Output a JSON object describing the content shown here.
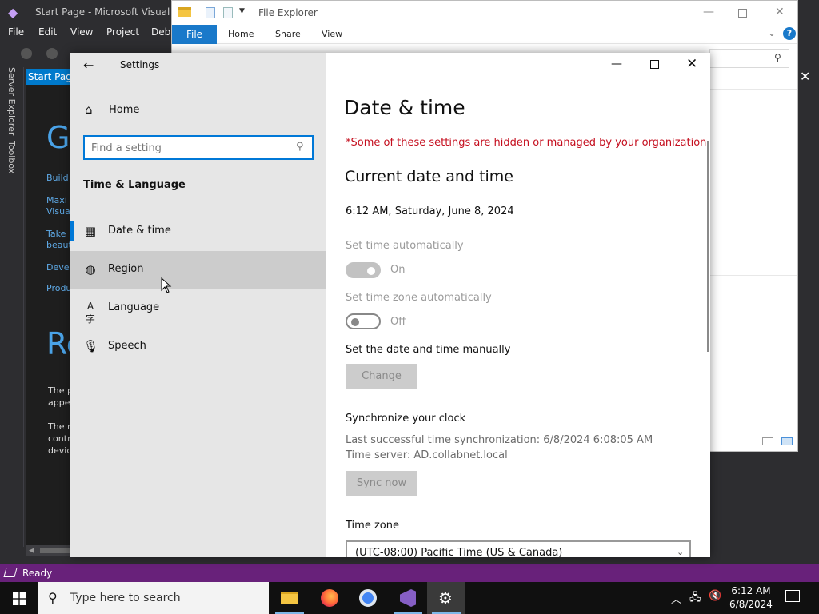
{
  "visual_studio": {
    "title": "Start Page - Microsoft Visual Stu",
    "menu": [
      "File",
      "Edit",
      "View",
      "Project",
      "Debu"
    ],
    "side_tabs": [
      "Server Explorer",
      "Toolbox"
    ],
    "doc_tab": "Start Page",
    "doc_fragments": {
      "heading1": "G",
      "link_build": "Build",
      "link_maxi_1": "Maxi",
      "link_maxi_2": "Visua",
      "link_take_1": "Take",
      "link_take_2": "beaut",
      "link_devel": "Devel",
      "link_produ": "Produ",
      "heading2": "Re",
      "text_p1_1": "The p",
      "text_p1_2": "appe",
      "text_p2_1": "The r",
      "text_p2_2": "contr",
      "text_p2_3": "devic"
    },
    "status": "Ready",
    "accent_color": "#68217a"
  },
  "file_explorer": {
    "title": "File Explorer",
    "ribbon_tabs": [
      "File",
      "Home",
      "Share",
      "View"
    ],
    "help_label": "?"
  },
  "settings": {
    "app_title": "Settings",
    "home_label": "Home",
    "search_placeholder": "Find a setting",
    "section_title": "Time & Language",
    "nav": [
      {
        "label": "Date & time",
        "icon": "calendar-clock-icon",
        "state": "selected"
      },
      {
        "label": "Region",
        "icon": "globe-icon",
        "state": "hover"
      },
      {
        "label": "Language",
        "icon": "language-icon",
        "state": "normal"
      },
      {
        "label": "Speech",
        "icon": "microphone-icon",
        "state": "normal"
      }
    ],
    "page": {
      "title": "Date & time",
      "managed_notice": "*Some of these settings are hidden or managed by your organization.",
      "current_heading": "Current date and time",
      "current_value": "6:12 AM, Saturday, June 8, 2024",
      "auto_time_label": "Set time automatically",
      "auto_time_state": "On",
      "auto_zone_label": "Set time zone automatically",
      "auto_zone_state": "Off",
      "manual_label": "Set the date and time manually",
      "change_button": "Change",
      "sync_heading": "Synchronize your clock",
      "sync_last": "Last successful time synchronization: 6/8/2024 6:08:05 AM",
      "sync_server": "Time server: AD.collabnet.local",
      "sync_button": "Sync now",
      "timezone_label": "Time zone",
      "timezone_value": "(UTC-08:00) Pacific Time (US & Canada)"
    },
    "colors": {
      "accent": "#0078d7",
      "warning": "#c50f1f"
    }
  },
  "taskbar": {
    "search_placeholder": "Type here to search",
    "apps": [
      "File Explorer",
      "Firefox",
      "Chrome",
      "Visual Studio",
      "Settings"
    ],
    "clock_time": "6:12 AM",
    "clock_date": "6/8/2024"
  }
}
